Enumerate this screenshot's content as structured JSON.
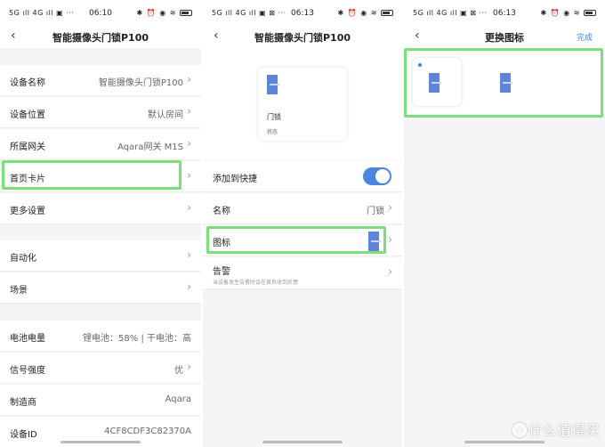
{
  "status_bar": {
    "signal_text": "5G ıll 4G ıll ▣ ···",
    "signal_text_b": "5G ıll 4G ıll ▣ ⊠ ···",
    "time_1": "06:10",
    "time_2": "06:13",
    "time_3": "06:13",
    "icons_text": "✱ ⏰ ◉ ≋"
  },
  "screen1": {
    "title": "智能摄像头门锁P100",
    "rows": [
      {
        "label": "设备名称",
        "value": "智能摄像头门锁P100",
        "chevron": "›"
      },
      {
        "label": "设备位置",
        "value": "默认房间",
        "chevron": "›"
      },
      {
        "label": "所属网关",
        "value": "Aqara网关 M1S",
        "chevron": "›"
      },
      {
        "label": "首页卡片",
        "value": "",
        "chevron": "›"
      },
      {
        "label": "更多设置",
        "value": "",
        "chevron": "›"
      },
      {
        "label": "自动化",
        "value": "",
        "chevron": "›"
      },
      {
        "label": "场景",
        "value": "",
        "chevron": "›"
      },
      {
        "label": "电池电量",
        "value": "锂电池：58% | 干电池：高",
        "chevron": ""
      },
      {
        "label": "信号强度",
        "value": "优",
        "chevron": "›"
      },
      {
        "label": "制造商",
        "value": "Aqara",
        "chevron": ""
      },
      {
        "label": "设备ID",
        "value": "4CF8CDF3C82370A",
        "chevron": ""
      }
    ]
  },
  "screen2": {
    "title": "智能摄像头门锁P100",
    "card_name": "门锁",
    "card_status": "状态",
    "rows": [
      {
        "label": "添加到快捷",
        "value": "",
        "chevron": ""
      },
      {
        "label": "名称",
        "value": "门锁",
        "chevron": "›"
      },
      {
        "label": "图标",
        "value": "",
        "chevron": "›"
      },
      {
        "label": "告警",
        "value": "",
        "chevron": "›",
        "sub": "当设备发生告警时会在首页收到反馈"
      }
    ],
    "shortcut_enabled": true
  },
  "screen3": {
    "title": "更换图标",
    "done_label": "完成",
    "selected_icon_index": 0
  },
  "nav": {
    "back_glyph": "‹"
  },
  "icons": {
    "back": "chevron-left-icon",
    "door": "door-lock-icon"
  },
  "colors": {
    "highlight": "#79e07a",
    "accent": "#4a7fe0",
    "icon_blue": "#5e86d8"
  },
  "watermark": {
    "text": "什么值得买"
  }
}
